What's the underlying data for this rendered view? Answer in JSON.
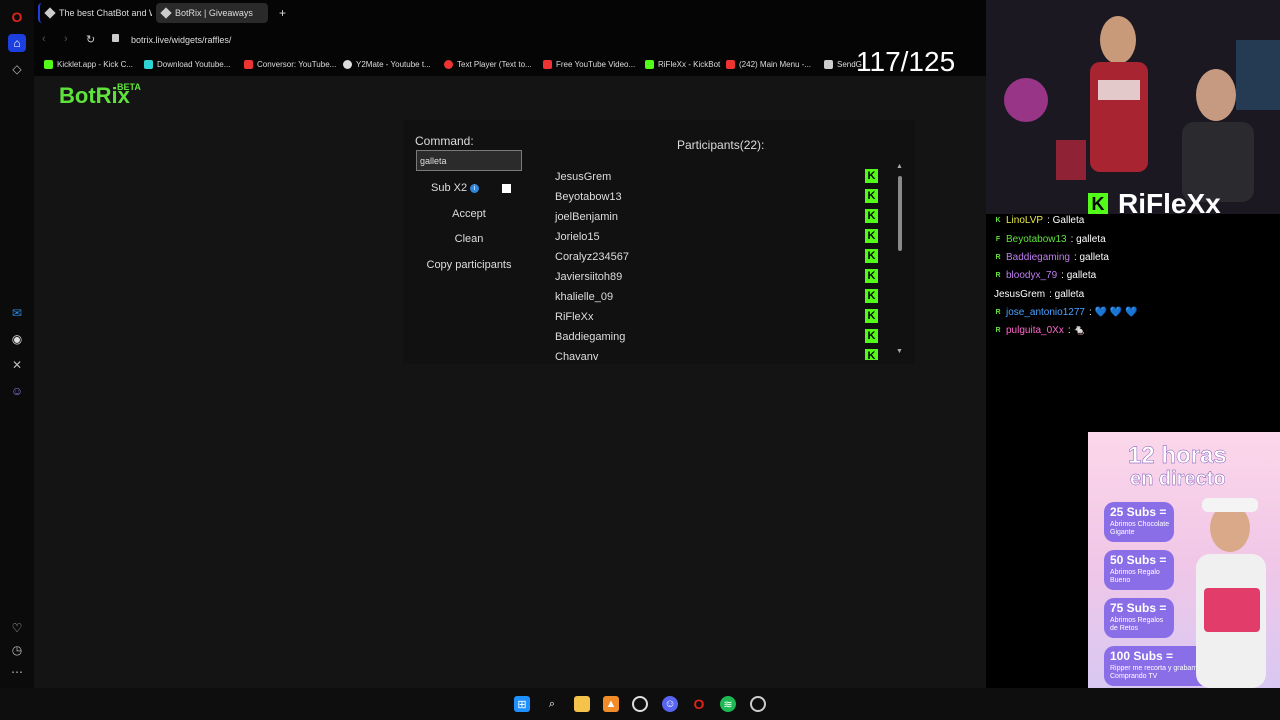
{
  "browser": {
    "tabs": [
      {
        "title": "The best ChatBot and Wi..."
      },
      {
        "title": "BotRix | Giveaways"
      }
    ],
    "new_tab": "+",
    "url": "botrix.live/widgets/raffles/",
    "bookmarks": [
      {
        "label": "Kicklet.app - Kick C...",
        "color": "#53fc18"
      },
      {
        "label": "Download Youtube...",
        "color": "#2ed3d3"
      },
      {
        "label": "Conversor: YouTube...",
        "color": "#e33"
      },
      {
        "label": "Y2Mate - Youtube t...",
        "color": "#ddd"
      },
      {
        "label": "Text Player (Text to...",
        "color": "#e33"
      },
      {
        "label": "Free YouTube Video...",
        "color": "#e33"
      },
      {
        "label": "RiFleXx - KickBot",
        "color": "#53fc18"
      },
      {
        "label": "(242) Main Menu -...",
        "color": "#e33"
      },
      {
        "label": "SendG",
        "color": "#ccc"
      }
    ]
  },
  "app": {
    "logo": "BotRix",
    "beta": "BETA",
    "command_label": "Command:",
    "command_value": "galleta",
    "sub_label": "Sub X2",
    "sub_info": "i",
    "accept": "Accept",
    "clean": "Clean",
    "copy": "Copy participants",
    "participants_title": "Participants(22):",
    "participants": [
      "JesusGrem",
      "Beyotabow13",
      "joelBenjamin",
      "Jorielo15",
      "Coralyz234567",
      "Javiersiitoh89",
      "khalielle_09",
      "RiFleXx",
      "Baddiegaming",
      "Chavany"
    ],
    "kick_glyph": "K"
  },
  "overlay": {
    "counter": "117/125",
    "streamer": "RiFleXx",
    "streamer_k": "K",
    "chat": [
      {
        "badge": "K",
        "user": "LinoLVP",
        "user_color": "#e8e84a",
        "msg": ": Galleta"
      },
      {
        "badge": "F",
        "user": "Beyotabow13",
        "user_color": "#5fe33c",
        "msg": ": galleta"
      },
      {
        "badge": "R",
        "user": "Baddiegaming",
        "user_color": "#c07ef0",
        "msg": ": galleta"
      },
      {
        "badge": "R",
        "user": "bloodyx_79",
        "user_color": "#c07ef0",
        "msg": ": galleta"
      },
      {
        "badge": "",
        "user": "JesusGrem",
        "user_color": "#ffffff",
        "msg": ": galleta"
      },
      {
        "badge": "R",
        "user": "jose_antonio1277",
        "user_color": "#4aa3ff",
        "msg": ": 💙 💙 💙"
      },
      {
        "badge": "R",
        "user": "pulguita_0Xx",
        "user_color": "#ff66cc",
        "msg": ": 🐁"
      }
    ],
    "poster": {
      "title1": "12 horas",
      "title2": "en directo",
      "goals": [
        {
          "big": "25 Subs =",
          "small": "Abrimos Chocolate Gigante"
        },
        {
          "big": "50 Subs =",
          "small": "Abrimos Regalo Bueno"
        },
        {
          "big": "75 Subs =",
          "small": "Abrimos Regalos de Retos"
        },
        {
          "big": "100 Subs =",
          "small": "Ripper me recorta y grabamos Blog Comprando TV"
        }
      ]
    }
  }
}
